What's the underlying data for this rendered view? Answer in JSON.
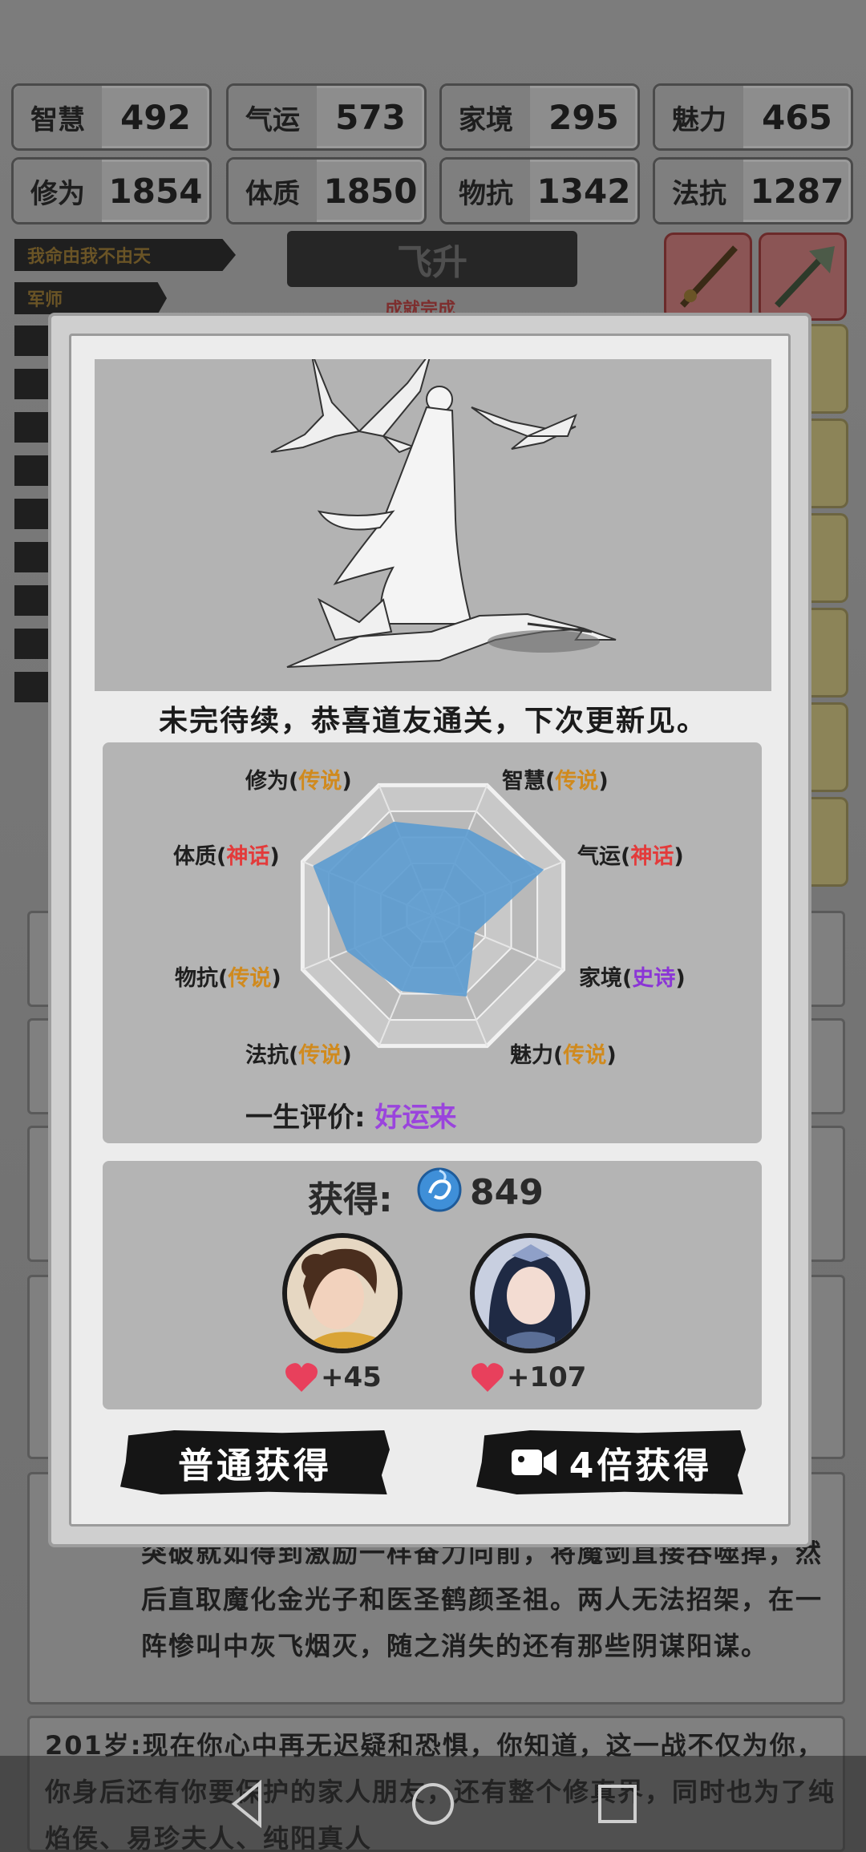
{
  "stats": [
    {
      "label": "智慧",
      "value": "492"
    },
    {
      "label": "气运",
      "value": "573"
    },
    {
      "label": "家境",
      "value": "295"
    },
    {
      "label": "魅力",
      "value": "465"
    },
    {
      "label": "修为",
      "value": "1854"
    },
    {
      "label": "体质",
      "value": "1850"
    },
    {
      "label": "物抗",
      "value": "1342"
    },
    {
      "label": "法抗",
      "value": "1287"
    }
  ],
  "tags": [
    "我命由我不由天",
    "军师"
  ],
  "ascend_banner": "飞升",
  "ascend_sub": "成就完成",
  "modal": {
    "ending_text": "未完待续，恭喜道友通关，下次更新见。",
    "radar": {
      "axes": [
        {
          "name": "修为",
          "rank": "传说",
          "value": 0.72
        },
        {
          "name": "智慧",
          "rank": "传说",
          "value": 0.66
        },
        {
          "name": "气运",
          "rank": "神话",
          "value": 0.85
        },
        {
          "name": "家境",
          "rank": "史诗",
          "value": 0.32
        },
        {
          "name": "魅力",
          "rank": "传说",
          "value": 0.62
        },
        {
          "name": "法抗",
          "rank": "传说",
          "value": 0.58
        },
        {
          "name": "物抗",
          "rank": "传说",
          "value": 0.66
        },
        {
          "name": "体质",
          "rank": "神话",
          "value": 0.92
        }
      ]
    },
    "evaluation_label": "一生评价:",
    "evaluation_value": "好运来",
    "reward_label": "获得:",
    "reward_amount": "849",
    "companions": [
      {
        "affinity": "+45"
      },
      {
        "affinity": "+107"
      }
    ],
    "normal_button": "普通获得",
    "quad_button": "4倍获得"
  },
  "story": {
    "line1": "突破就如得到激励一样奋力向前，将魔剑直接吞噬掉，然后直取魔化金光子和医圣鹤颜圣祖。两人无法招架，在一阵惨叫中灰飞烟灭，随之消失的还有那些阴谋阳谋。",
    "line2": "201岁:现在你心中再无迟疑和恐惧，你知道，这一战不仅为你，你身后还有你要保护的家人朋友，还有整个修真界，同时也为了纯焰侯、易珍夫人、纯阳真人"
  },
  "colors": {
    "radar_fill": "#5b9bd0",
    "rank_legend": "#d08a1e",
    "rank_myth": "#e33b3b",
    "rank_epic": "#8b35d6"
  }
}
